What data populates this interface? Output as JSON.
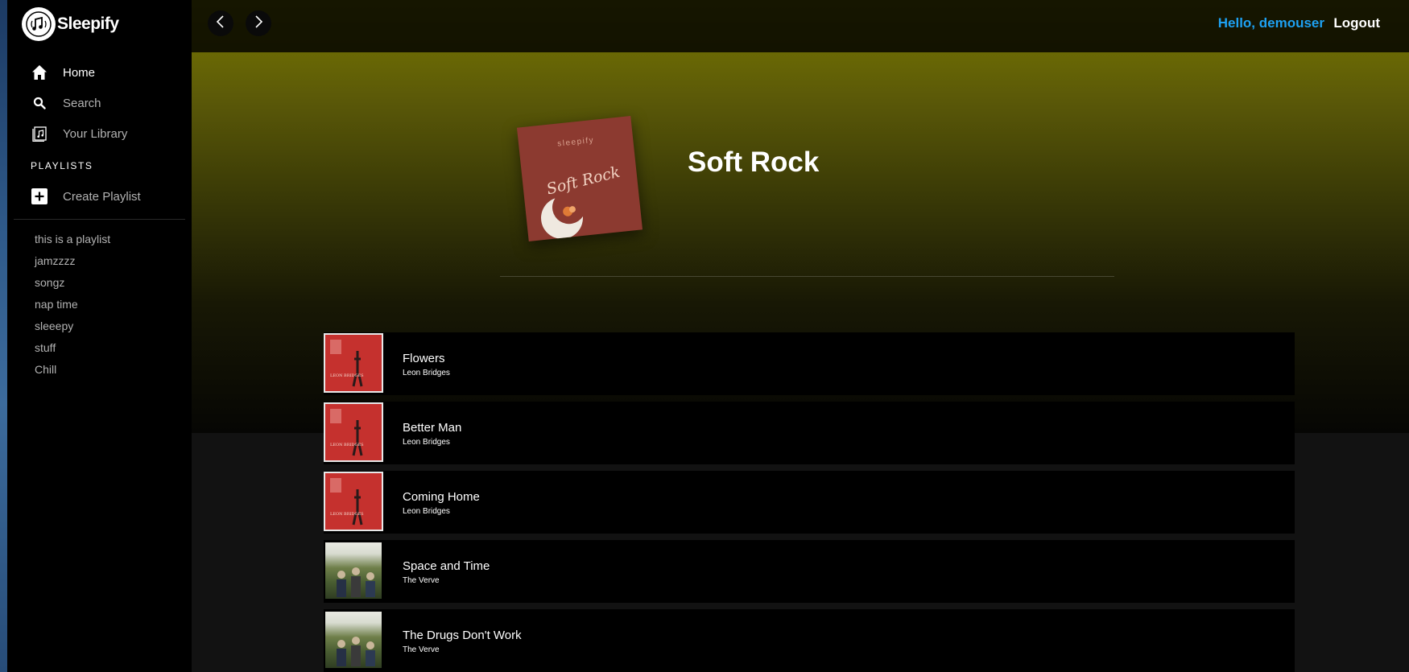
{
  "app": {
    "name": "Sleepify"
  },
  "sidebar": {
    "nav": [
      {
        "label": "Home",
        "icon": "home-icon",
        "active": true
      },
      {
        "label": "Search",
        "icon": "search-icon"
      },
      {
        "label": "Your Library",
        "icon": "library-icon"
      }
    ],
    "section_title": "PLAYLISTS",
    "create_label": "Create Playlist",
    "playlists": [
      "this is a playlist",
      "jamzzzz",
      "songz",
      "nap time",
      "sleeepy",
      "stuff",
      "Chill"
    ]
  },
  "header": {
    "greeting": "Hello, demouser",
    "logout": "Logout"
  },
  "playlist": {
    "title": "Soft Rock",
    "cover_brand": "sleepify",
    "cover_text": "Soft Rock",
    "hero_color": "#7a7a00"
  },
  "songs": [
    {
      "title": "Flowers",
      "artist": "Leon Bridges",
      "art": "red"
    },
    {
      "title": "Better Man",
      "artist": "Leon Bridges",
      "art": "red"
    },
    {
      "title": "Coming Home",
      "artist": "Leon Bridges",
      "art": "red"
    },
    {
      "title": "Space and Time",
      "artist": "The Verve",
      "art": "green"
    },
    {
      "title": "The Drugs Don't Work",
      "artist": "The Verve",
      "art": "green"
    }
  ],
  "colors": {
    "accent": "#1ea1f2",
    "sidebar_bg": "#000000",
    "main_bg": "#121212"
  }
}
